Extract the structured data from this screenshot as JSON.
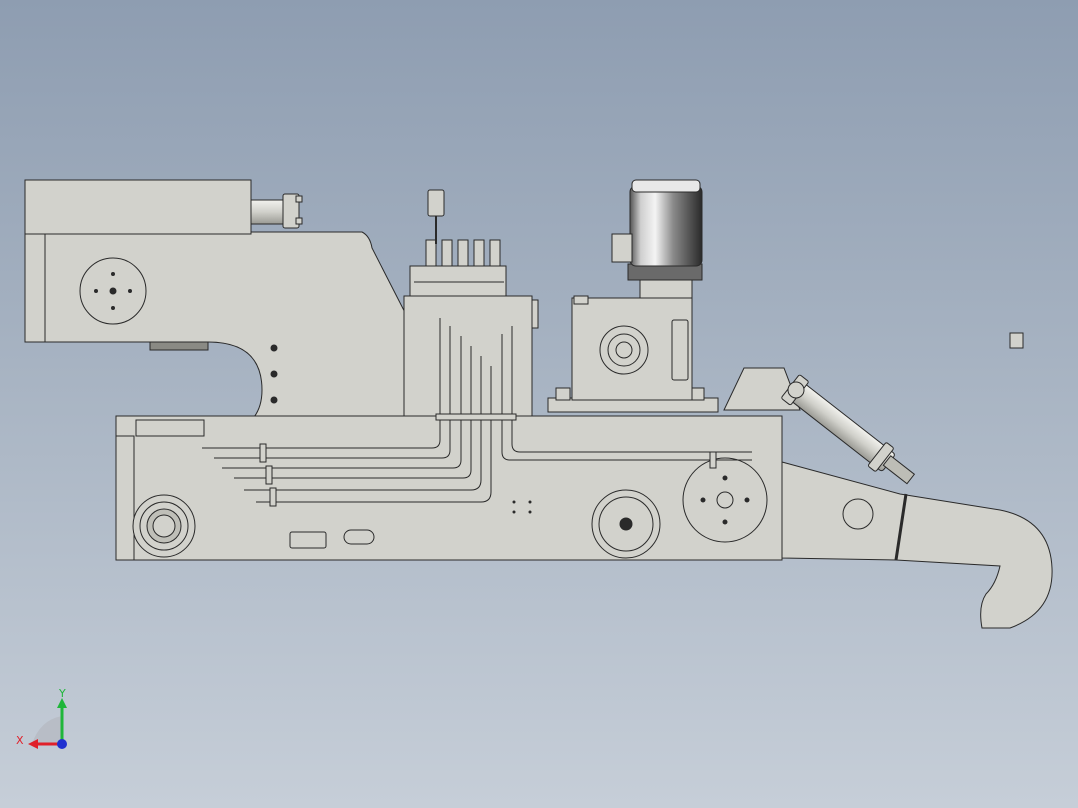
{
  "viewport": {
    "background_top": "#8e9db1",
    "background_bottom": "#c6ced8",
    "part_fill": "#d2d2cc",
    "part_stroke": "#2a2a2a"
  },
  "triad": {
    "x_label": "X",
    "y_label": "Y",
    "x_color": "#e0202a",
    "y_color": "#1fb63a",
    "z_color": "#2030d0"
  },
  "components": [
    "c-frame",
    "upper-jaw-block",
    "top-hydraulic-cylinder",
    "main-base-frame",
    "hydraulic-valve-block",
    "valve-lever",
    "hydraulic-tank",
    "hydraulic-pipes",
    "electric-motor",
    "gearbox",
    "hook-arm",
    "side-hydraulic-cylinder",
    "bearing-housing"
  ]
}
